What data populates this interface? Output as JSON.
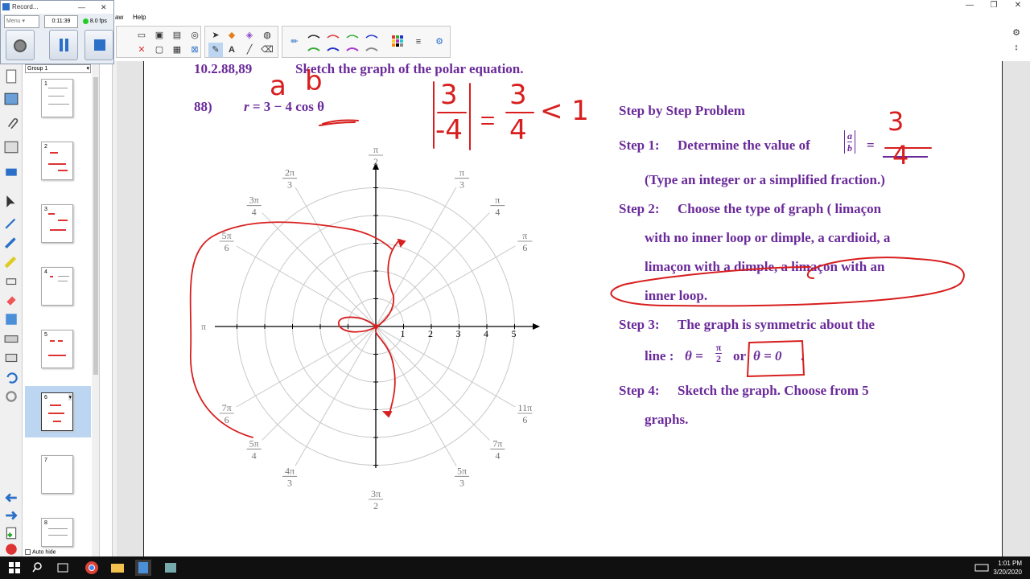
{
  "recorder": {
    "title": "Record...",
    "menu_label": "Menu",
    "elapsed": "0:11:39",
    "fps": "8.0 fps"
  },
  "menubar": {
    "partial_item": "aw",
    "help": "Help"
  },
  "sidebar": {
    "group_label": "Group 1",
    "thumbnails": [
      "1",
      "2",
      "3",
      "4",
      "5",
      "6",
      "7",
      "8"
    ],
    "selected_index": 6,
    "autohide_label": "Auto hide"
  },
  "problem": {
    "header_number": "10.2.88,89",
    "header_text": "Sketch the graph of the polar equation.",
    "number": "88)",
    "equation_lhs": "r",
    "equation_rhs": "= 3 − 4 cos θ"
  },
  "handwriting": {
    "label_a": "a",
    "label_b": "b",
    "frac_num": "3",
    "frac_den": "-4",
    "result_num": "3",
    "result_den": "4",
    "compare": "< 1",
    "answer_num": "3",
    "answer_den": "4"
  },
  "polar_plot": {
    "radial_labels": [
      "1",
      "2",
      "3",
      "4",
      "5"
    ],
    "angle_labels": [
      "π/2",
      "π/3",
      "π/4",
      "π/6",
      "π",
      "2π/3",
      "3π/4",
      "5π/6",
      "7π/6",
      "5π/4",
      "4π/3",
      "3π/2",
      "5π/3",
      "7π/4",
      "11π/6"
    ],
    "curve_color": "#d81e1e"
  },
  "steps": {
    "title": "Step by Step Problem",
    "step1_label": "Step 1:",
    "step1_text": "Determine the value of",
    "step1_abs": "|a/b| =",
    "step1_hint": "(Type an integer or a simplified fraction.)",
    "step2_label": "Step 2:",
    "step2_line1": "Choose the type of graph ( limaçon",
    "step2_line2": "with no inner loop or dimple, a cardioid, a",
    "step2_line3": "limaçon with a dimple, a limaçon with an",
    "step2_line4": "inner loop.",
    "step3_label": "Step 3:",
    "step3_line1": "The graph is symmetric about the",
    "step3_line2a": "line :",
    "step3_theta1": "θ =",
    "step3_pi2": "π/2",
    "step3_or": "or",
    "step3_theta0": "θ = 0",
    "step3_period": ".",
    "step4_label": "Step 4:",
    "step4_line1": "Sketch the graph.  Choose from 5",
    "step4_line2": "graphs."
  },
  "taskbar": {
    "time": "1:01 PM",
    "date": "3/20/2020"
  },
  "colors": {
    "text_purple": "#6a2a9a",
    "ink_red": "#d81e1e",
    "grid_gray": "#c8c8c8"
  }
}
